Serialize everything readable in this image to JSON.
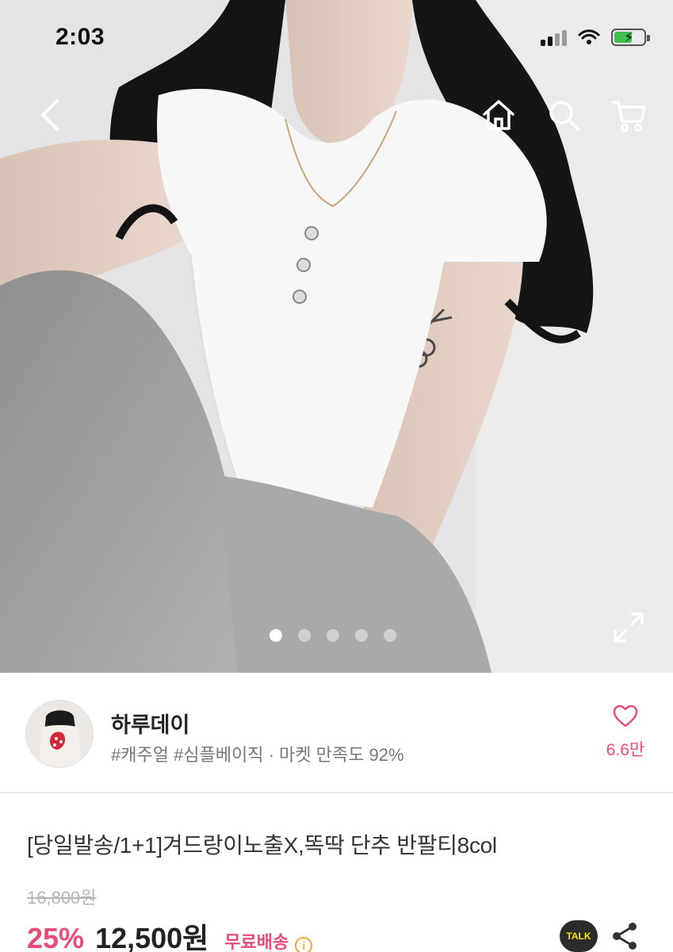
{
  "status_bar": {
    "time": "2:03"
  },
  "nav": {
    "back_icon": "chevron-left-icon",
    "home_icon": "home-icon",
    "search_icon": "search-icon",
    "cart_icon": "cart-icon"
  },
  "gallery": {
    "image_count": 5,
    "active_index": 0,
    "expand_icon": "expand-icon"
  },
  "seller": {
    "name": "하루데이",
    "tags": "#캐주얼 #심플베이직 · 마켓 만족도 92%",
    "like_count": "6.6만"
  },
  "product": {
    "title": "[당일발송/1+1]겨드랑이노출X,똑딱 단추 반팔티8col",
    "original_price": "16,800원",
    "discount": "25%",
    "price": "12,500원",
    "shipping": "무료배송",
    "talk_label": "TALK"
  },
  "colors": {
    "accent": "#e94b7b",
    "info": "#f0a830"
  }
}
